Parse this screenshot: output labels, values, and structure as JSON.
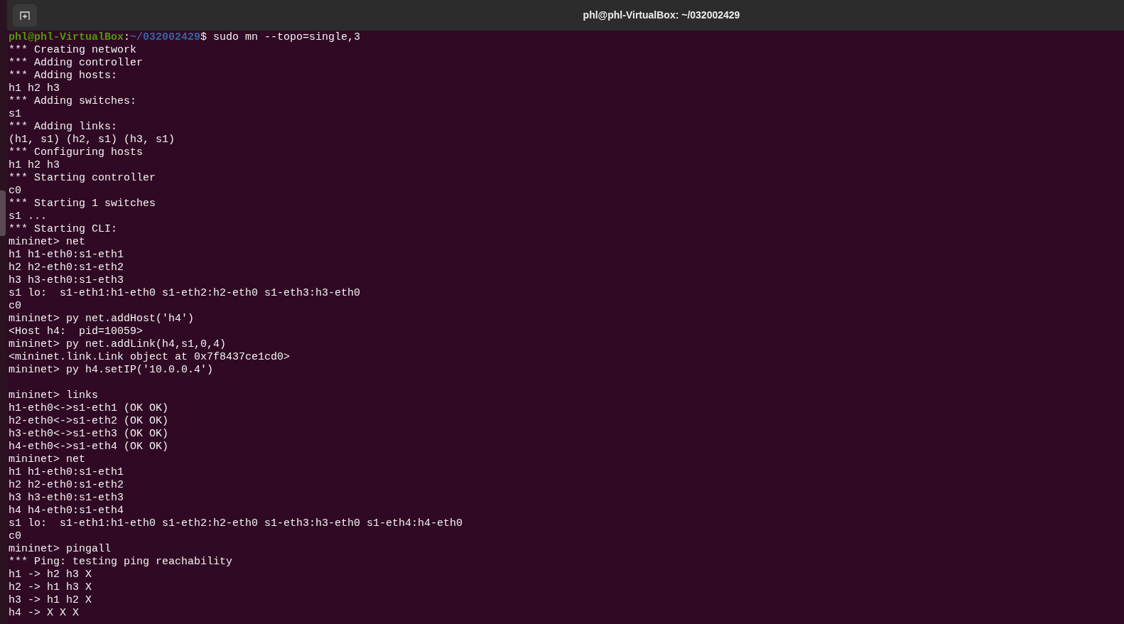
{
  "window": {
    "title": "phl@phl-VirtualBox: ~/032002429"
  },
  "terminal": {
    "lines": [
      {
        "kind": "prompt",
        "user_host": "phl@phl-VirtualBox",
        "separator": ":",
        "path": "~/032002429",
        "command": "$ sudo mn --topo=single,3"
      },
      {
        "kind": "output",
        "text": "*** Creating network"
      },
      {
        "kind": "output",
        "text": "*** Adding controller"
      },
      {
        "kind": "output",
        "text": "*** Adding hosts:"
      },
      {
        "kind": "output",
        "text": "h1 h2 h3"
      },
      {
        "kind": "output",
        "text": "*** Adding switches:"
      },
      {
        "kind": "output",
        "text": "s1"
      },
      {
        "kind": "output",
        "text": "*** Adding links:"
      },
      {
        "kind": "output",
        "text": "(h1, s1) (h2, s1) (h3, s1)"
      },
      {
        "kind": "output",
        "text": "*** Configuring hosts"
      },
      {
        "kind": "output",
        "text": "h1 h2 h3"
      },
      {
        "kind": "output",
        "text": "*** Starting controller"
      },
      {
        "kind": "output",
        "text": "c0"
      },
      {
        "kind": "output",
        "text": "*** Starting 1 switches"
      },
      {
        "kind": "output",
        "text": "s1 ..."
      },
      {
        "kind": "output",
        "text": "*** Starting CLI:"
      },
      {
        "kind": "output",
        "text": "mininet> net"
      },
      {
        "kind": "output",
        "text": "h1 h1-eth0:s1-eth1"
      },
      {
        "kind": "output",
        "text": "h2 h2-eth0:s1-eth2"
      },
      {
        "kind": "output",
        "text": "h3 h3-eth0:s1-eth3"
      },
      {
        "kind": "output",
        "text": "s1 lo:  s1-eth1:h1-eth0 s1-eth2:h2-eth0 s1-eth3:h3-eth0"
      },
      {
        "kind": "output",
        "text": "c0"
      },
      {
        "kind": "output",
        "text": "mininet> py net.addHost('h4')"
      },
      {
        "kind": "output",
        "text": "<Host h4:  pid=10059>"
      },
      {
        "kind": "output",
        "text": "mininet> py net.addLink(h4,s1,0,4)"
      },
      {
        "kind": "output",
        "text": "<mininet.link.Link object at 0x7f8437ce1cd0>"
      },
      {
        "kind": "output",
        "text": "mininet> py h4.setIP('10.0.0.4')"
      },
      {
        "kind": "blank"
      },
      {
        "kind": "output",
        "text": "mininet> links"
      },
      {
        "kind": "output",
        "text": "h1-eth0<->s1-eth1 (OK OK)"
      },
      {
        "kind": "output",
        "text": "h2-eth0<->s1-eth2 (OK OK)"
      },
      {
        "kind": "output",
        "text": "h3-eth0<->s1-eth3 (OK OK)"
      },
      {
        "kind": "output",
        "text": "h4-eth0<->s1-eth4 (OK OK)"
      },
      {
        "kind": "output",
        "text": "mininet> net"
      },
      {
        "kind": "output",
        "text": "h1 h1-eth0:s1-eth1"
      },
      {
        "kind": "output",
        "text": "h2 h2-eth0:s1-eth2"
      },
      {
        "kind": "output",
        "text": "h3 h3-eth0:s1-eth3"
      },
      {
        "kind": "output",
        "text": "h4 h4-eth0:s1-eth4"
      },
      {
        "kind": "output",
        "text": "s1 lo:  s1-eth1:h1-eth0 s1-eth2:h2-eth0 s1-eth3:h3-eth0 s1-eth4:h4-eth0"
      },
      {
        "kind": "output",
        "text": "c0"
      },
      {
        "kind": "output",
        "text": "mininet> pingall"
      },
      {
        "kind": "output",
        "text": "*** Ping: testing ping reachability"
      },
      {
        "kind": "output",
        "text": "h1 -> h2 h3 X"
      },
      {
        "kind": "output",
        "text": "h2 -> h1 h3 X"
      },
      {
        "kind": "output",
        "text": "h3 -> h1 h2 X"
      },
      {
        "kind": "output",
        "text": "h4 -> X X X"
      }
    ]
  }
}
